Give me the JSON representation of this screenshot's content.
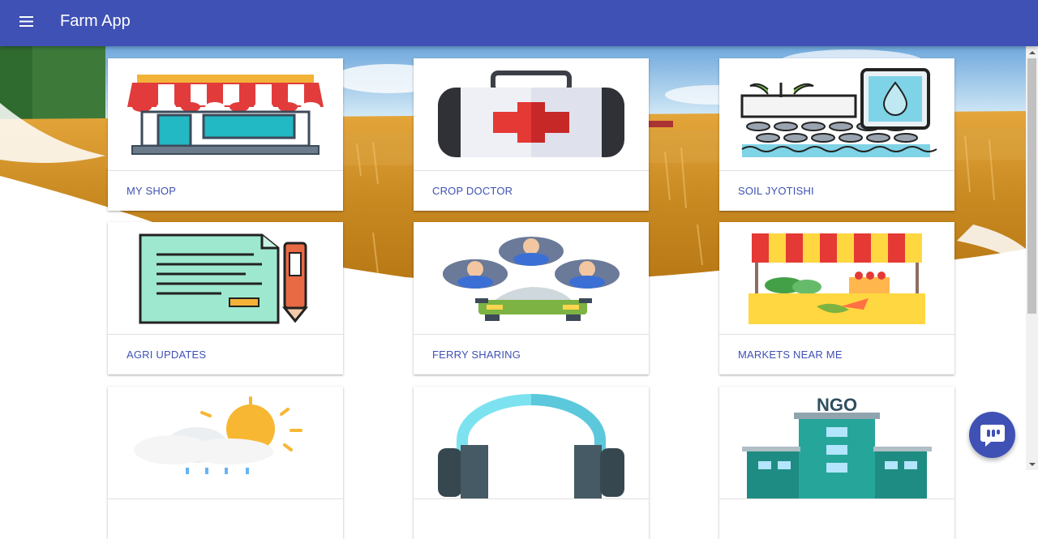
{
  "app_bar": {
    "title": "Farm App",
    "menu_icon": "menu-icon",
    "color": "#3f51b5"
  },
  "cards": [
    {
      "label": "MY SHOP",
      "icon": "shop-icon"
    },
    {
      "label": "CROP DOCTOR",
      "icon": "first-aid-kit-icon"
    },
    {
      "label": "SOIL JYOTISHI",
      "icon": "soil-phone-icon"
    },
    {
      "label": "AGRI UPDATES",
      "icon": "document-pen-icon"
    },
    {
      "label": "FERRY SHARING",
      "icon": "car-people-icon"
    },
    {
      "label": "MARKETS NEAR ME",
      "icon": "market-stall-icon"
    },
    {
      "label": "",
      "icon": "weather-icon"
    },
    {
      "label": "",
      "icon": "headphones-icon"
    },
    {
      "label": "",
      "icon": "ngo-building-icon",
      "sign_text": "NGO"
    }
  ],
  "chat_fab": {
    "icon": "chat-icon"
  },
  "colors": {
    "accent": "#3f51b5",
    "label": "#3f51b5"
  }
}
